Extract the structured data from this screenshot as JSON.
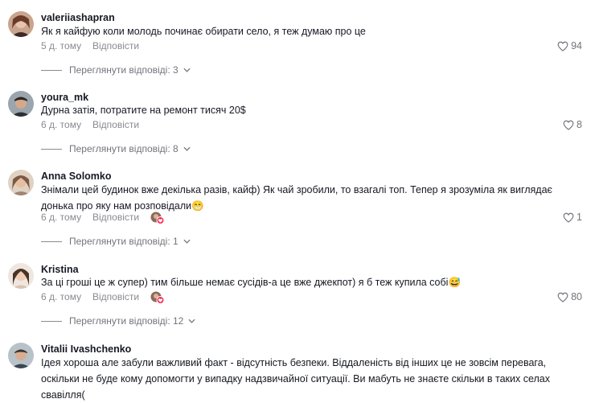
{
  "comments": [
    {
      "username": "valeriiashapran",
      "text": "Як я кайфую коли молодь починає обирати село, я теж думаю про це",
      "date": "5 д. тому",
      "reply_label": "Відповісти",
      "likes": "94",
      "view_replies": "Переглянути відповіді: 3",
      "creator_liked": false
    },
    {
      "username": "youra_mk",
      "text": "Дурна затія, потратите на ремонт тисяч 20$",
      "date": "6 д. тому",
      "reply_label": "Відповісти",
      "likes": "8",
      "view_replies": "Переглянути відповіді: 8",
      "creator_liked": false
    },
    {
      "username": "Anna Solomko",
      "text": "Знімали цей будинок вже декілька разів, кайф) Як чай зробили, то взагалі топ. Тепер я зрозуміла як виглядає донька про яку нам розповідали😁",
      "date": "6 д. тому",
      "reply_label": "Відповісти",
      "likes": "1",
      "view_replies": "Переглянути відповіді: 1",
      "creator_liked": true
    },
    {
      "username": "Kristina",
      "text": "За ці гроші це ж супер) тим більше немає сусідів-а це вже джекпот) я б теж купила собі😅",
      "date": "6 д. тому",
      "reply_label": "Відповісти",
      "likes": "80",
      "view_replies": "Переглянути відповіді: 12",
      "creator_liked": true
    },
    {
      "username": "Vitalii Ivashchenko",
      "text": "Ідея хороша але забули важливий факт - відсутність безпеки. Віддаленість від інших це не зовсім перевага, оскільки не буде кому допомогти у випадку надзвичайної ситуації. Ви мабуть не знаєте скільки в таких селах свавілля(",
      "date": "",
      "reply_label": "",
      "likes": "",
      "view_replies": "",
      "creator_liked": false
    }
  ],
  "colors": {
    "text": "#161823",
    "muted": "#8a8b91",
    "creator_badge": "#fe2c55"
  }
}
